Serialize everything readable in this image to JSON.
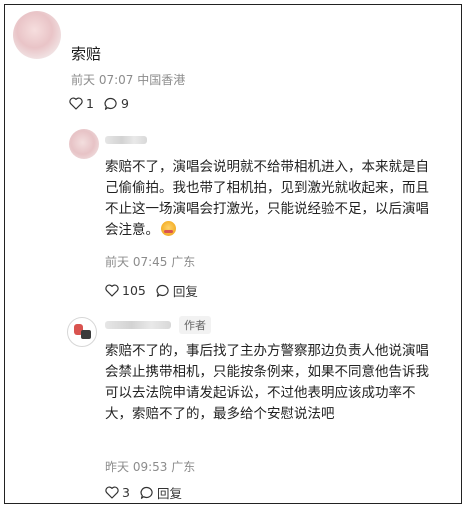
{
  "root_comment": {
    "title": "索赔",
    "meta": "前天 07:07 中国香港",
    "likes": "1",
    "replies": "9"
  },
  "replies": [
    {
      "username": "",
      "content": "索赔不了，演唱会说明就不给带相机进入，本来就是自己偷偷拍。我也带了相机拍，见到激光就收起来，而且不止这一场演唱会打激光，只能说经验不足，以后演唱会注意。",
      "emoji_name": "crying-face-emoji",
      "meta": "前天 07:45 广东",
      "likes": "105",
      "reply_label": "回复"
    },
    {
      "username": "",
      "author_badge": "作者",
      "content": "索赔不了的，事后找了主办方警察那边负责人他说演唱会禁止携带相机，只能按条例来，如果不同意他告诉我可以去法院申请发起诉讼，不过他表明应该成功率不大，索赔不了的，最多给个安慰说法吧",
      "meta": "昨天 09:53 广东",
      "likes": "3",
      "reply_label": "回复"
    }
  ],
  "icons": {
    "like": "heart-outline-icon",
    "comment": "comment-bubble-icon"
  },
  "colors": {
    "meta_text": "#8c8c8c",
    "body_text": "#222222"
  }
}
